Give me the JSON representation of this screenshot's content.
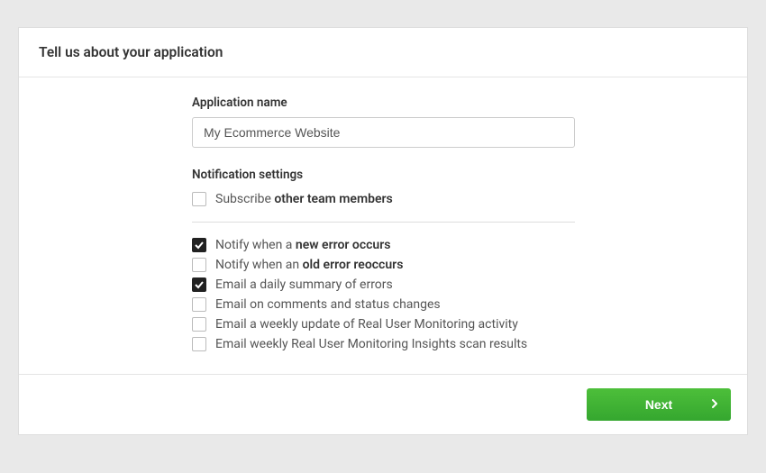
{
  "header": {
    "title": "Tell us about your application"
  },
  "form": {
    "appname_label": "Application name",
    "appname_value": "My Ecommerce Website",
    "notif_label": "Notification settings",
    "subscribe": {
      "checked": false,
      "prefix": "Subscribe ",
      "strong": "other team members",
      "suffix": ""
    },
    "opts": [
      {
        "checked": true,
        "prefix": "Notify when a ",
        "strong": "new error occurs",
        "suffix": ""
      },
      {
        "checked": false,
        "prefix": "Notify when an ",
        "strong": "old error reoccurs",
        "suffix": ""
      },
      {
        "checked": true,
        "prefix": "Email a daily summary of errors",
        "strong": "",
        "suffix": ""
      },
      {
        "checked": false,
        "prefix": "Email on comments and status changes",
        "strong": "",
        "suffix": ""
      },
      {
        "checked": false,
        "prefix": "Email a weekly update of Real User Monitoring activity",
        "strong": "",
        "suffix": ""
      },
      {
        "checked": false,
        "prefix": "Email weekly Real User Monitoring Insights scan results",
        "strong": "",
        "suffix": ""
      }
    ]
  },
  "footer": {
    "next_label": "Next"
  }
}
